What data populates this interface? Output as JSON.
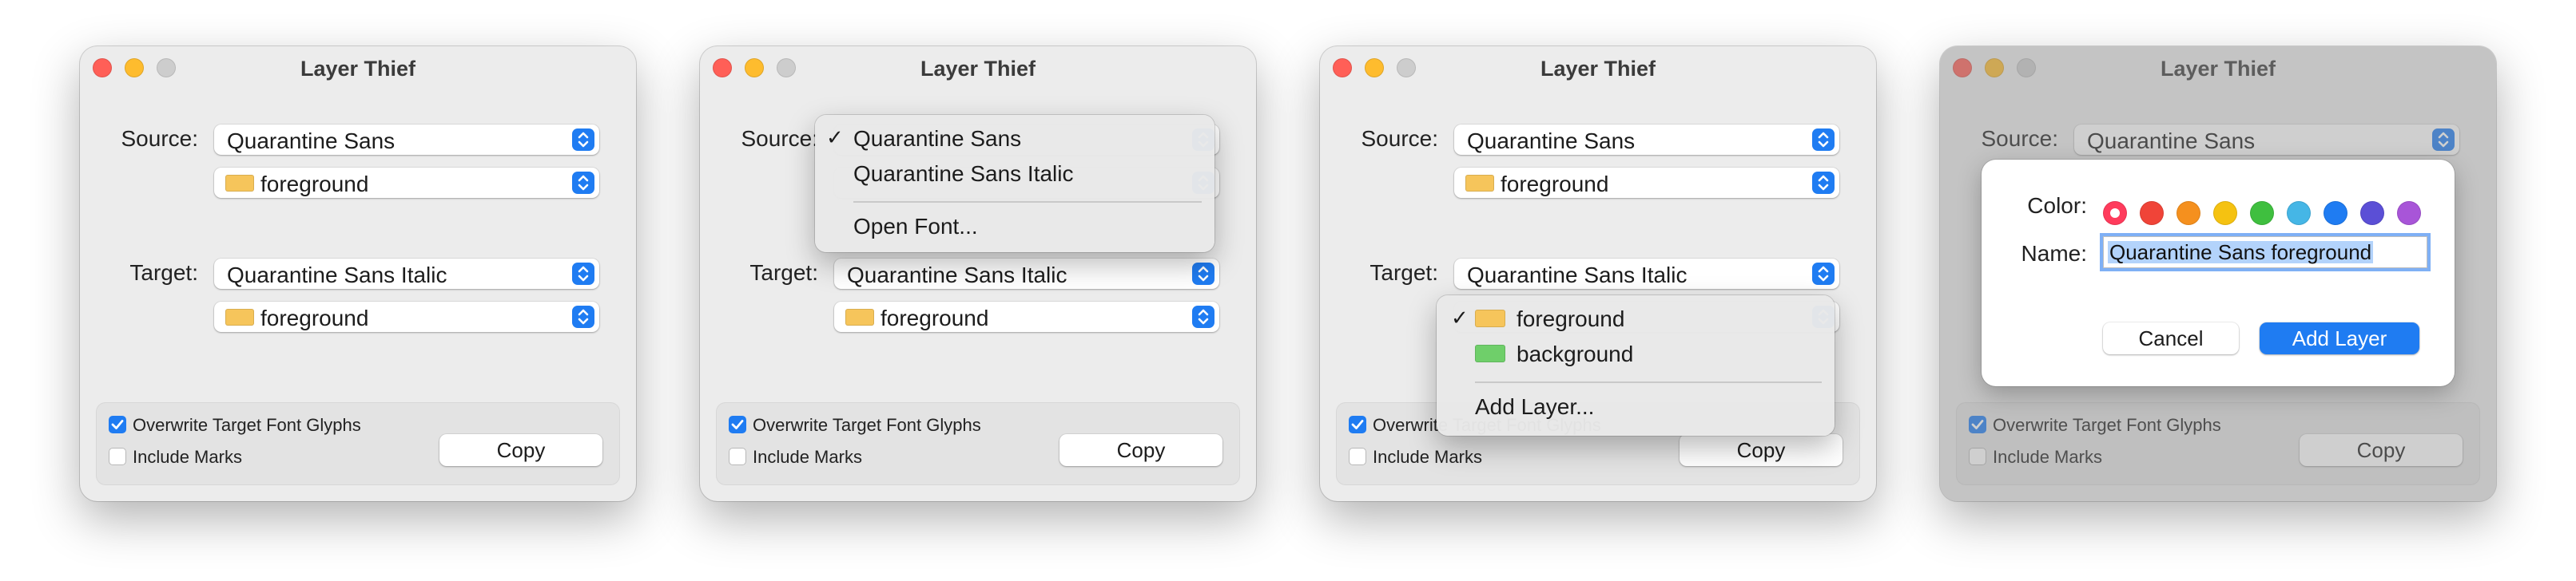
{
  "window_title": "Layer Thief",
  "source_label": "Source:",
  "target_label": "Target:",
  "source_font": "Quarantine Sans",
  "source_layer": "foreground",
  "target_font": "Quarantine Sans Italic",
  "target_layer": "foreground",
  "overwrite_label": "Overwrite Target Font Glyphs",
  "overwrite_checked": true,
  "include_marks_label": "Include Marks",
  "include_marks_checked": false,
  "copy_label": "Copy",
  "font_menu": {
    "items": [
      "Quarantine Sans",
      "Quarantine Sans Italic"
    ],
    "checked_item": "Quarantine Sans",
    "open_font": "Open Font..."
  },
  "layer_menu": {
    "items": [
      {
        "label": "foreground",
        "color": "#f6c55b",
        "checked": true
      },
      {
        "label": "background",
        "color": "#6fcf6a",
        "checked": false
      }
    ],
    "add_layer": "Add Layer..."
  },
  "add_layer_sheet": {
    "color_label": "Color:",
    "colors": [
      "#ff3b5c",
      "#f04438",
      "#f5901e",
      "#f5c211",
      "#3fbf3f",
      "#45b6e6",
      "#1f7cf2",
      "#5b4fd6",
      "#a855d8"
    ],
    "selected_color_index": 0,
    "name_label": "Name:",
    "name_value": "Quarantine Sans foreground",
    "cancel_label": "Cancel",
    "add_label": "Add Layer"
  },
  "accent_color": "#1f7cf2"
}
